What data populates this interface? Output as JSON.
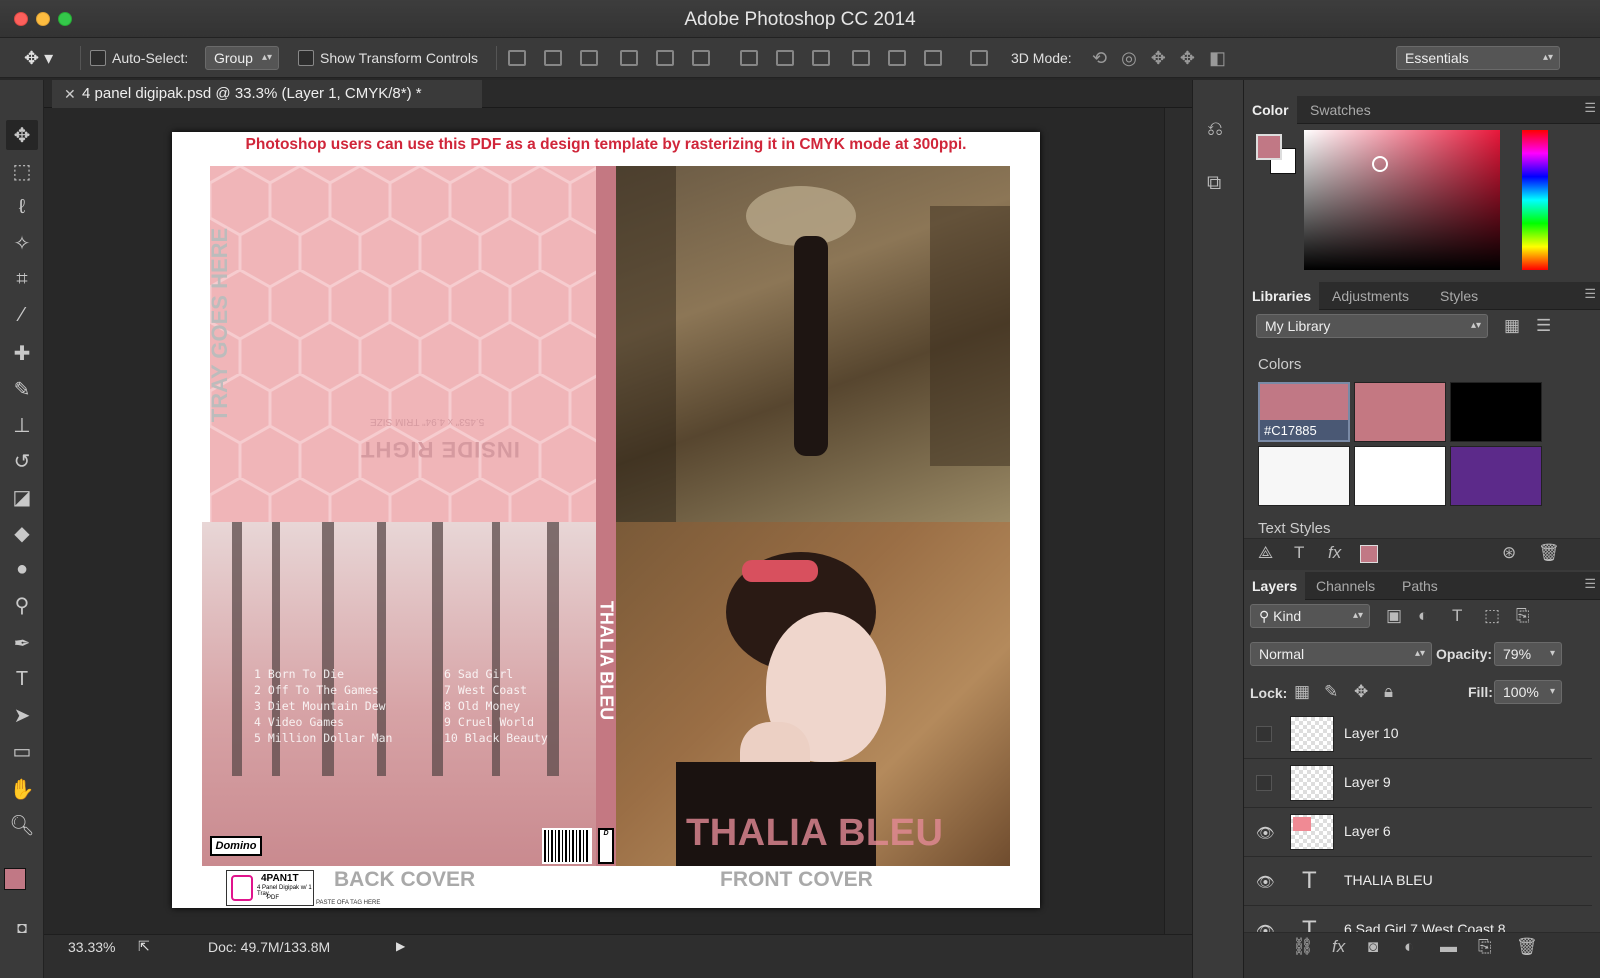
{
  "window": {
    "title": "Adobe Photoshop CC 2014"
  },
  "options_bar": {
    "auto_select_label": "Auto-Select:",
    "auto_select_value": "Group",
    "show_transform_label": "Show Transform Controls",
    "mode_3d_label": "3D Mode:",
    "workspace_value": "Essentials"
  },
  "document": {
    "tab_title": "4 panel digipak.psd @ 33.3% (Layer 1, CMYK/8*) *",
    "pdf_note": "Photoshop users can use this PDF as a design template by rasterizing it in CMYK mode at 300ppi.",
    "tray_label": "TRAY GOES HERE",
    "inside_right": "INSIDE RIGHT",
    "trim_size": "5.453\" x 4.94\" TRIM SIZE",
    "spine_text": "THALIA BLEU",
    "cover_title": "THALIA BLEU",
    "back_cover_label": "BACK COVER",
    "front_cover_label": "FRONT COVER",
    "logo_text": "Domino",
    "tag_title": "4PAN1T",
    "tag_sub": "4 Panel Digipak w/ 1 Tray",
    "tag_pdf": "PDF",
    "tag_note": "PASTE OFA TAG HERE",
    "tracks_left": [
      "1 Born To Die",
      "2 Off To The Games",
      "3 Diet Mountain Dew",
      "4 Video Games",
      "5 Million Dollar Man"
    ],
    "tracks_right": [
      "6 Sad Girl",
      "7 West Coast",
      "8 Old Money",
      "9 Cruel World",
      "10 Black Beauty"
    ]
  },
  "status": {
    "zoom": "33.33%",
    "doc_size": "Doc: 49.7M/133.8M"
  },
  "color_panel": {
    "tabs": [
      "Color",
      "Swatches"
    ],
    "foreground": "#c17885",
    "background": "#ffffff"
  },
  "libraries_panel": {
    "tabs": [
      "Libraries",
      "Adjustments",
      "Styles"
    ],
    "library_value": "My Library",
    "colors_heading": "Colors",
    "swatches": [
      {
        "color": "#c17885",
        "label": "#C17885"
      },
      {
        "color": "#c47882",
        "label": ""
      },
      {
        "color": "#000000",
        "label": ""
      },
      {
        "color": "#f7f7f7",
        "label": ""
      },
      {
        "color": "#ffffff",
        "label": ""
      },
      {
        "color": "#5c2a8a",
        "label": ""
      }
    ],
    "text_styles_heading": "Text Styles"
  },
  "layers_panel": {
    "tabs": [
      "Layers",
      "Channels",
      "Paths"
    ],
    "filter_value": "Kind",
    "blend_mode": "Normal",
    "opacity_label": "Opacity:",
    "opacity_value": "79%",
    "lock_label": "Lock:",
    "fill_label": "Fill:",
    "fill_value": "100%",
    "layers": [
      {
        "name": "Layer 10",
        "visible": false,
        "type": "pixel"
      },
      {
        "name": "Layer 9",
        "visible": false,
        "type": "pixel"
      },
      {
        "name": "Layer 6",
        "visible": true,
        "type": "pixel"
      },
      {
        "name": "THALIA BLEU",
        "visible": true,
        "type": "text"
      },
      {
        "name": "6 Sad Girl 7 West Coast 8",
        "visible": true,
        "type": "text"
      }
    ]
  }
}
